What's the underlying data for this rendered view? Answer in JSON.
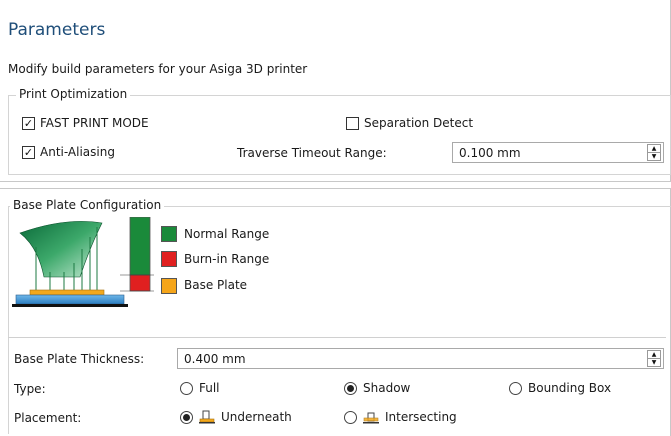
{
  "header": {
    "title": "Parameters",
    "subtitle": "Modify build parameters for your Asiga 3D printer"
  },
  "print_optimization": {
    "legend": "Print Optimization",
    "fast_print_mode": {
      "label": "FAST PRINT MODE",
      "checked": true
    },
    "separation_detect": {
      "label": "Separation Detect",
      "checked": false
    },
    "anti_aliasing": {
      "label": "Anti-Aliasing",
      "checked": true
    },
    "traverse_timeout": {
      "label": "Traverse Timeout Range:",
      "value": "0.100 mm"
    }
  },
  "base_plate": {
    "legend": "Base Plate Configuration",
    "legend_items": [
      {
        "label": "Normal Range",
        "color": "#1a8a3a"
      },
      {
        "label": "Burn-in Range",
        "color": "#e02020"
      },
      {
        "label": "Base Plate",
        "color": "#f5a51a"
      }
    ],
    "thickness": {
      "label": "Base Plate Thickness:",
      "value": "0.400 mm"
    },
    "type": {
      "label": "Type:",
      "options": [
        "Full",
        "Shadow",
        "Bounding Box"
      ],
      "selected": "Shadow"
    },
    "placement": {
      "label": "Placement:",
      "options": [
        "Underneath",
        "Intersecting"
      ],
      "selected": "Underneath"
    }
  },
  "icons": {
    "check": "✓",
    "spin_up": "▲",
    "spin_down": "▼"
  }
}
